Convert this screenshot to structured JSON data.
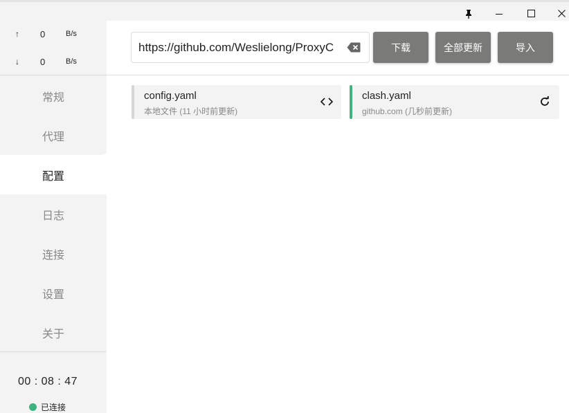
{
  "window": {
    "pin_icon": "pin-icon",
    "minimize_icon": "minimize-icon",
    "maximize_icon": "maximize-icon",
    "close_icon": "close-icon"
  },
  "traffic": {
    "upload": {
      "arrow": "↑",
      "value": "0",
      "unit": "B/s"
    },
    "download": {
      "arrow": "↓",
      "value": "0",
      "unit": "B/s"
    }
  },
  "nav": {
    "items": [
      {
        "label": "常规"
      },
      {
        "label": "代理"
      },
      {
        "label": "配置"
      },
      {
        "label": "日志"
      },
      {
        "label": "连接"
      },
      {
        "label": "设置"
      },
      {
        "label": "关于"
      }
    ],
    "active_index": 2
  },
  "footer": {
    "timer": "00 : 08 : 47",
    "status": "已连接",
    "status_color": "#3fb37f"
  },
  "toolbar": {
    "url_value": "https://github.com/Weslielong/ProxyC",
    "download_label": "下载",
    "update_all_label": "全部更新",
    "import_label": "导入",
    "button_color": "#7a7a78"
  },
  "profiles": [
    {
      "name": "config.yaml",
      "sub": "本地文件 (11 小时前更新)",
      "bar_color": "#d6d6d6",
      "icon": "code-icon"
    },
    {
      "name": "clash.yaml",
      "sub": "github.com (几秒前更新)",
      "bar_color": "#3fb37f",
      "icon": "refresh-icon"
    }
  ]
}
